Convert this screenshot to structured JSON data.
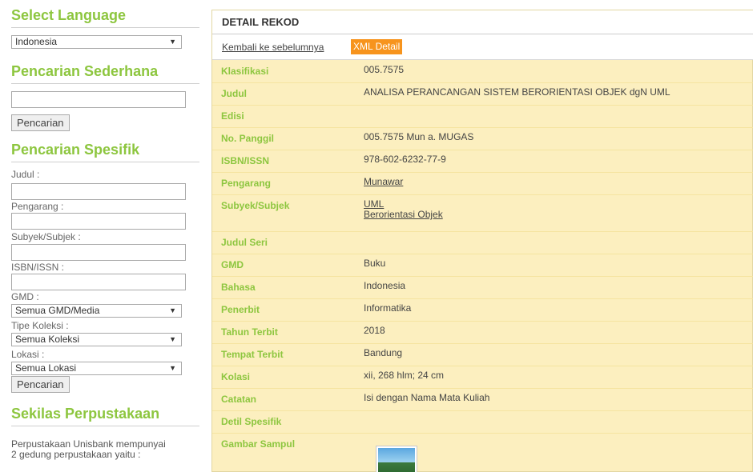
{
  "sidebar": {
    "select_language": {
      "heading": "Select Language",
      "selected": "Indonesia"
    },
    "simple_search": {
      "heading": "Pencarian Sederhana",
      "button": "Pencarian"
    },
    "specific_search": {
      "heading": "Pencarian Spesifik",
      "title_label": "Judul :",
      "author_label": "Pengarang :",
      "subject_label": "Subyek/Subjek :",
      "isbn_label": "ISBN/ISSN :",
      "gmd_label": "GMD :",
      "gmd_selected": "Semua GMD/Media",
      "collection_label": "Tipe Koleksi :",
      "collection_selected": "Semua Koleksi",
      "location_label": "Lokasi :",
      "location_selected": "Semua Lokasi",
      "button": "Pencarian"
    },
    "library_info": {
      "heading": "Sekilas Perpustakaan",
      "text_line1": "Perpustakaan Unisbank mempunyai",
      "text_line2": "2 gedung perpustakaan yaitu :"
    }
  },
  "main": {
    "header": "DETAIL REKOD",
    "back_link": "Kembali ke sebelumnya",
    "xml_button": "XML Detail",
    "rows": [
      {
        "label": "Klasifikasi",
        "value": "005.7575"
      },
      {
        "label": "Judul",
        "value": "ANALISA PERANCANGAN SISTEM BERORIENTASI OBJEK dgN UML"
      },
      {
        "label": "Edisi",
        "value": ""
      },
      {
        "label": "No. Panggil",
        "value": "005.7575 Mun a. MUGAS"
      },
      {
        "label": "ISBN/ISSN",
        "value": "978-602-6232-77-9"
      },
      {
        "label": "Pengarang",
        "link": "Munawar"
      },
      {
        "label": "Subyek/Subjek",
        "link1": "UML",
        "link2": "Berorientasi Objek"
      },
      {
        "label": "Judul Seri",
        "value": ""
      },
      {
        "label": "GMD",
        "value": "Buku"
      },
      {
        "label": "Bahasa",
        "value": "Indonesia"
      },
      {
        "label": "Penerbit",
        "value": "Informatika"
      },
      {
        "label": "Tahun Terbit",
        "value": "2018"
      },
      {
        "label": "Tempat Terbit",
        "value": "Bandung"
      },
      {
        "label": "Kolasi",
        "value": "xii, 268 hlm; 24 cm"
      },
      {
        "label": "Catatan",
        "value": "Isi dengan Nama Mata Kuliah"
      },
      {
        "label": "Detil Spesifik",
        "value": ""
      },
      {
        "label": "Gambar Sampul",
        "value": ""
      }
    ]
  },
  "colors": {
    "accent_green": "#8dc63f",
    "panel_background": "#fcefbf",
    "xml_button_orange": "#f7941d"
  }
}
